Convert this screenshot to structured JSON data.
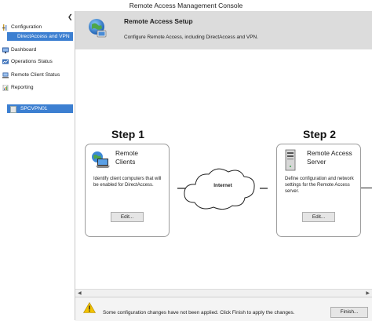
{
  "window": {
    "title": "Remote Access Management Console"
  },
  "sidebar": {
    "items": [
      {
        "label": "Configuration",
        "icon": "configuration-icon"
      },
      {
        "label": "DirectAccess and VPN",
        "selected": true
      },
      {
        "label": "Dashboard",
        "icon": "dashboard-icon"
      },
      {
        "label": "Operations Status",
        "icon": "operations-status-icon"
      },
      {
        "label": "Remote Client Status",
        "icon": "remote-client-status-icon"
      },
      {
        "label": "Reporting",
        "icon": "reporting-icon"
      }
    ],
    "server": {
      "label": "SPCVPN01",
      "icon": "server-icon"
    }
  },
  "header": {
    "title": "Remote Access Setup",
    "subtitle": "Configure Remote Access, including DirectAccess and VPN."
  },
  "steps": [
    {
      "title": "Step 1",
      "name_line1": "Remote",
      "name_line2": "Clients",
      "description": "Identify client computers that will be enabled for DirectAccess.",
      "button": "Edit...",
      "icon": "laptop-globe-icon"
    },
    {
      "title": "Step 2",
      "name_line1": "Remote Access",
      "name_line2": "Server",
      "description": "Define configuration and network settings for the Remote Access server.",
      "button": "Edit...",
      "icon": "server-tower-icon"
    }
  ],
  "network": {
    "label": "Internet"
  },
  "notification": {
    "message": "Some configuration changes have not been applied. Click Finish to apply the changes.",
    "button": "Finish...",
    "icon": "warning-icon"
  },
  "colors": {
    "selection": "#3c7fd1",
    "header_band": "#dcdcdc",
    "warning": "#f2c200"
  }
}
